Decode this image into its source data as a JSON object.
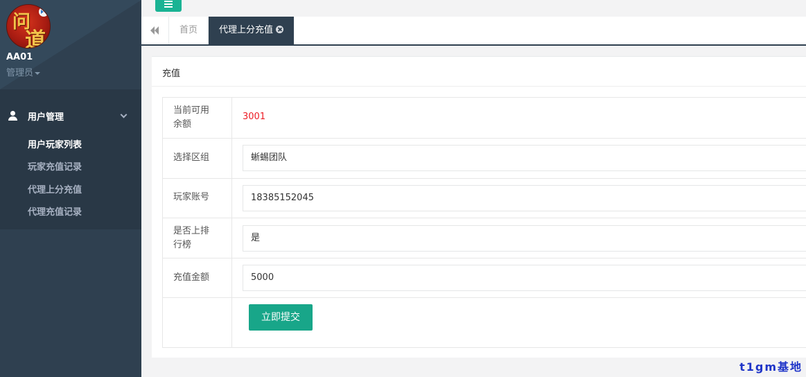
{
  "profile": {
    "username": "AA01",
    "role": "管理员",
    "avatar_text": [
      "问",
      "道"
    ]
  },
  "menu": {
    "group_title": "用户管理",
    "items": [
      {
        "label": "用户玩家列表",
        "active": true
      },
      {
        "label": "玩家充值记录",
        "active": false
      },
      {
        "label": "代理上分充值",
        "active": false
      },
      {
        "label": "代理充值记录",
        "active": false
      }
    ]
  },
  "tabs": {
    "home": "首页",
    "current": "代理上分充值"
  },
  "panel": {
    "title": "充值",
    "fields": {
      "balance": {
        "label_line1": "当前可用",
        "label_line2": "余额",
        "value": "3001"
      },
      "group": {
        "label": "选择区组",
        "value": "蜥蜴团队"
      },
      "account": {
        "label": "玩家账号",
        "value": "18385152045"
      },
      "ranking": {
        "label_line1": "是否上排",
        "label_line2": "行榜",
        "value": "是"
      },
      "amount": {
        "label": "充值金额",
        "value": "5000"
      }
    },
    "submit_label": "立即提交"
  },
  "watermark": "t1gm基地",
  "colors": {
    "sidebar": "#2f4050",
    "accent": "#1ab394",
    "submit": "#18a689",
    "balance": "#ed1c24"
  }
}
